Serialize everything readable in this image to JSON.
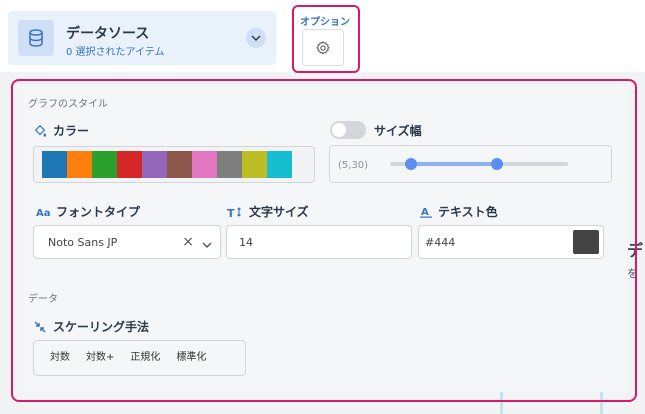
{
  "datasource": {
    "title": "データソース",
    "subtitle": "0 選択されたアイテム"
  },
  "options": {
    "label": "オプション"
  },
  "graph_style": {
    "section_label": "グラフのスタイル",
    "color": {
      "label": "カラー",
      "swatches": [
        "#1f77b4",
        "#ff7f0e",
        "#2ca02c",
        "#d62728",
        "#9467bd",
        "#8c564b",
        "#e377c2",
        "#7f7f7f",
        "#bcbd22",
        "#17becf"
      ]
    },
    "size_width": {
      "label": "サイズ幅",
      "enabled": false,
      "range_text": "(5,30)",
      "min_fraction": 0.12,
      "max_fraction": 0.6
    },
    "font_type": {
      "label": "フォントタイプ",
      "value": "Noto Sans JP"
    },
    "text_size": {
      "label": "文字サイズ",
      "value": "14"
    },
    "text_color": {
      "label": "テキスト色",
      "value": "#444"
    }
  },
  "data_section": {
    "section_label": "データ",
    "scaling": {
      "label": "スケーリング手法",
      "options": [
        "対数",
        "対数+",
        "正規化",
        "標準化"
      ]
    }
  },
  "colors": {
    "accent_blue": "#3573c4",
    "highlight_pink": "#d9196a"
  }
}
